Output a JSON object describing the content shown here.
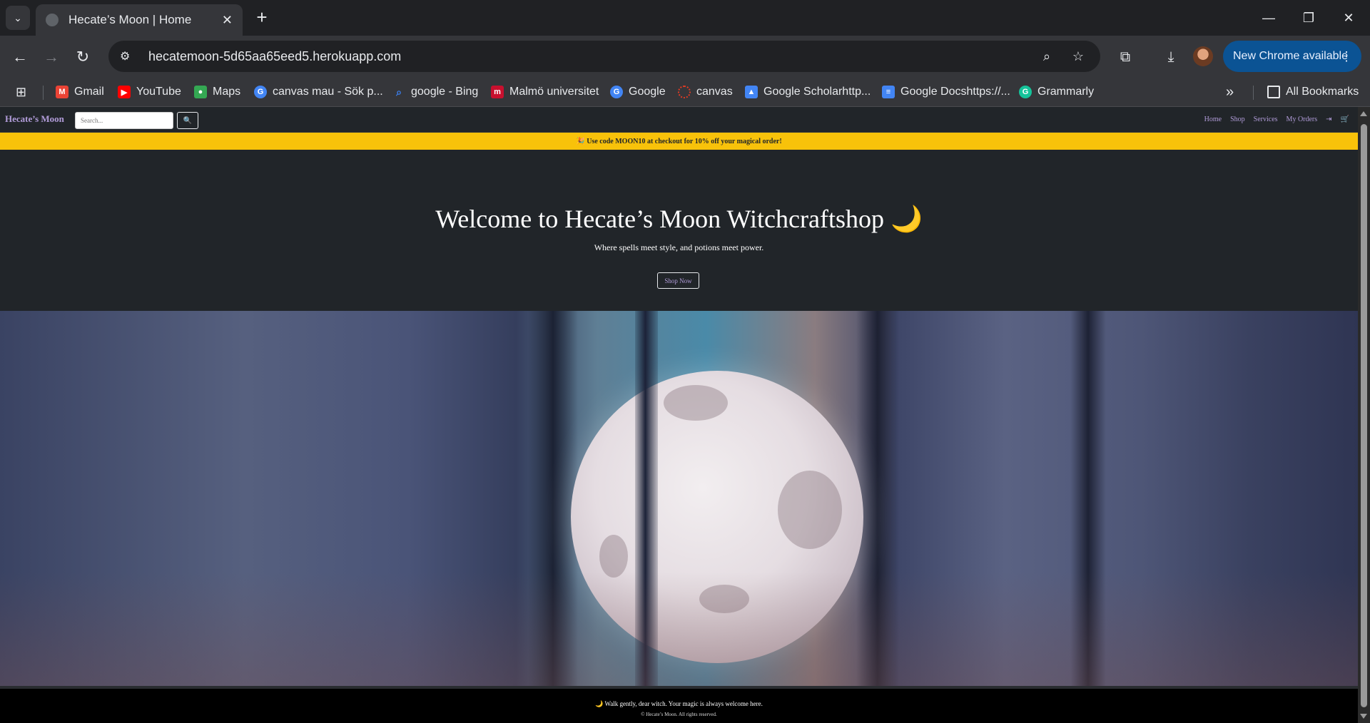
{
  "browser": {
    "tab_title": "Hecate’s Moon | Home",
    "url": "hecatemoon-5d65aa65eed5.herokuapp.com",
    "update_label": "New Chrome available",
    "all_bookmarks_label": "All Bookmarks",
    "bookmarks": [
      {
        "label": "Gmail",
        "icon": "gmail-icon",
        "color": "#ea4335"
      },
      {
        "label": "YouTube",
        "icon": "youtube-icon",
        "color": "#ff0000"
      },
      {
        "label": "Maps",
        "icon": "maps-icon",
        "color": "#34a853"
      },
      {
        "label": "canvas mau - Sök p...",
        "icon": "google-icon",
        "color": "#4285f4"
      },
      {
        "label": "google - Bing",
        "icon": "search-icon",
        "color": "#3b82f6"
      },
      {
        "label": "Malmö universitet",
        "icon": "mau-icon",
        "color": "#c8102e"
      },
      {
        "label": "Google",
        "icon": "google-icon",
        "color": "#4285f4"
      },
      {
        "label": "canvas",
        "icon": "canvas-icon",
        "color": "#e03b24"
      },
      {
        "label": "Google Scholarhttp...",
        "icon": "scholar-icon",
        "color": "#4285f4"
      },
      {
        "label": "Google Docshttps://...",
        "icon": "docs-icon",
        "color": "#4285f4"
      },
      {
        "label": "Grammarly",
        "icon": "grammarly-icon",
        "color": "#15c39a"
      }
    ]
  },
  "site": {
    "brand": "Hecate’s Moon",
    "search_placeholder": "Search...",
    "search_button": "🔍",
    "nav": [
      "Home",
      "Shop",
      "Services",
      "My Orders"
    ],
    "logout_icon": "⇥",
    "cart_icon": "🛒",
    "promo": "🎉 Use code MOON10 at checkout for 10% off your magical order!",
    "hero": {
      "title": "Welcome to Hecate’s Moon Witchcraftshop 🌙",
      "subtitle": "Where spells meet style, and potions meet power.",
      "cta": "Shop Now"
    },
    "footer": {
      "line1": "🌙 Walk gently, dear witch. Your magic is always welcome here.",
      "line2": "© Hecate’s Moon. All rights reserved."
    }
  },
  "colors": {
    "accent": "#b19cd9",
    "promo_bg": "#f8c20a",
    "page_bg": "#212529",
    "chrome_pill": "#0b5394"
  }
}
